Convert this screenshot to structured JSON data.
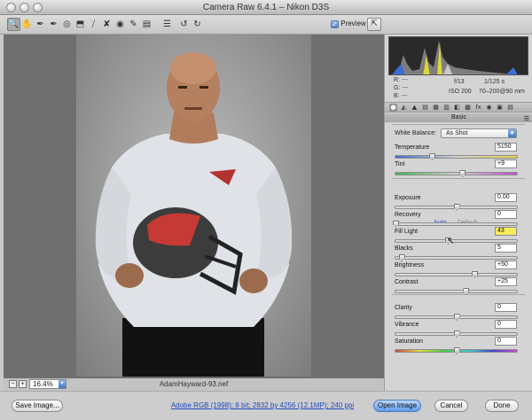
{
  "window": {
    "title": "Camera Raw 6.4.1  –  Nikon D3S"
  },
  "toolbar": {
    "tools": [
      {
        "name": "zoom-tool",
        "glyph": "🔍"
      },
      {
        "name": "hand-tool",
        "glyph": "✋"
      },
      {
        "name": "white-balance-tool",
        "glyph": "✒"
      },
      {
        "name": "color-sampler-tool",
        "glyph": "✒"
      },
      {
        "name": "targeted-adjustment-tool",
        "glyph": "◎"
      },
      {
        "name": "crop-tool",
        "glyph": "⬒"
      },
      {
        "name": "straighten-tool",
        "glyph": "⧸"
      },
      {
        "name": "spot-removal-tool",
        "glyph": "✘"
      },
      {
        "name": "red-eye-tool",
        "glyph": "◉"
      },
      {
        "name": "adjustment-brush-tool",
        "glyph": "✎"
      },
      {
        "name": "graduated-filter-tool",
        "glyph": "▤"
      },
      {
        "name": "preferences-tool",
        "glyph": "☰"
      },
      {
        "name": "rotate-left-tool",
        "glyph": "↺"
      },
      {
        "name": "rotate-right-tool",
        "glyph": "↻"
      }
    ],
    "preview_label": "Preview",
    "preview_checked": true
  },
  "image": {
    "filename": "AdamHayward-93.nef",
    "zoom": "16.4%"
  },
  "histogram_info": {
    "r": "R:   ---",
    "g": "G:   ---",
    "b": "B:   ---",
    "aperture": "f/13",
    "shutter": "1/125 s",
    "iso": "ISO 200",
    "lens": "70–200@90 mm"
  },
  "panel": {
    "section_title": "Basic",
    "white_balance_label": "White Balance:",
    "white_balance_value": "As Shot",
    "auto_label": "Auto",
    "default_label": "Default",
    "adjustments": [
      {
        "label": "Temperature",
        "value": "5150",
        "level": 0.3,
        "track": "temp"
      },
      {
        "label": "Tint",
        "value": "+9",
        "level": 0.55,
        "track": "tint"
      },
      {
        "label": "Exposure",
        "value": "0.00",
        "level": 0.5,
        "track": ""
      },
      {
        "label": "Recovery",
        "value": "0",
        "level": 0.0,
        "track": ""
      },
      {
        "label": "Fill Light",
        "value": "43",
        "level": 0.43,
        "track": "",
        "highlight": true
      },
      {
        "label": "Blacks",
        "value": "5",
        "level": 0.05,
        "track": ""
      },
      {
        "label": "Brightness",
        "value": "+50",
        "level": 0.65,
        "track": ""
      },
      {
        "label": "Contrast",
        "value": "+25",
        "level": 0.58,
        "track": ""
      },
      {
        "label": "Clarity",
        "value": "0",
        "level": 0.5,
        "track": ""
      },
      {
        "label": "Vibrance",
        "value": "0",
        "level": 0.5,
        "track": ""
      },
      {
        "label": "Saturation",
        "value": "0",
        "level": 0.5,
        "track": "sat"
      }
    ]
  },
  "bottom": {
    "save_label": "Save Image...",
    "workflow_label": "Adobe RGB (1998); 8 bit; 2832 by 4256 (12.1MP); 240 ppi",
    "open_label": "Open Image",
    "cancel_label": "Cancel",
    "done_label": "Done"
  },
  "colors": {
    "accent": "#3f78c9",
    "highlight": "#f5ec5a",
    "link": "#1f49c2"
  }
}
